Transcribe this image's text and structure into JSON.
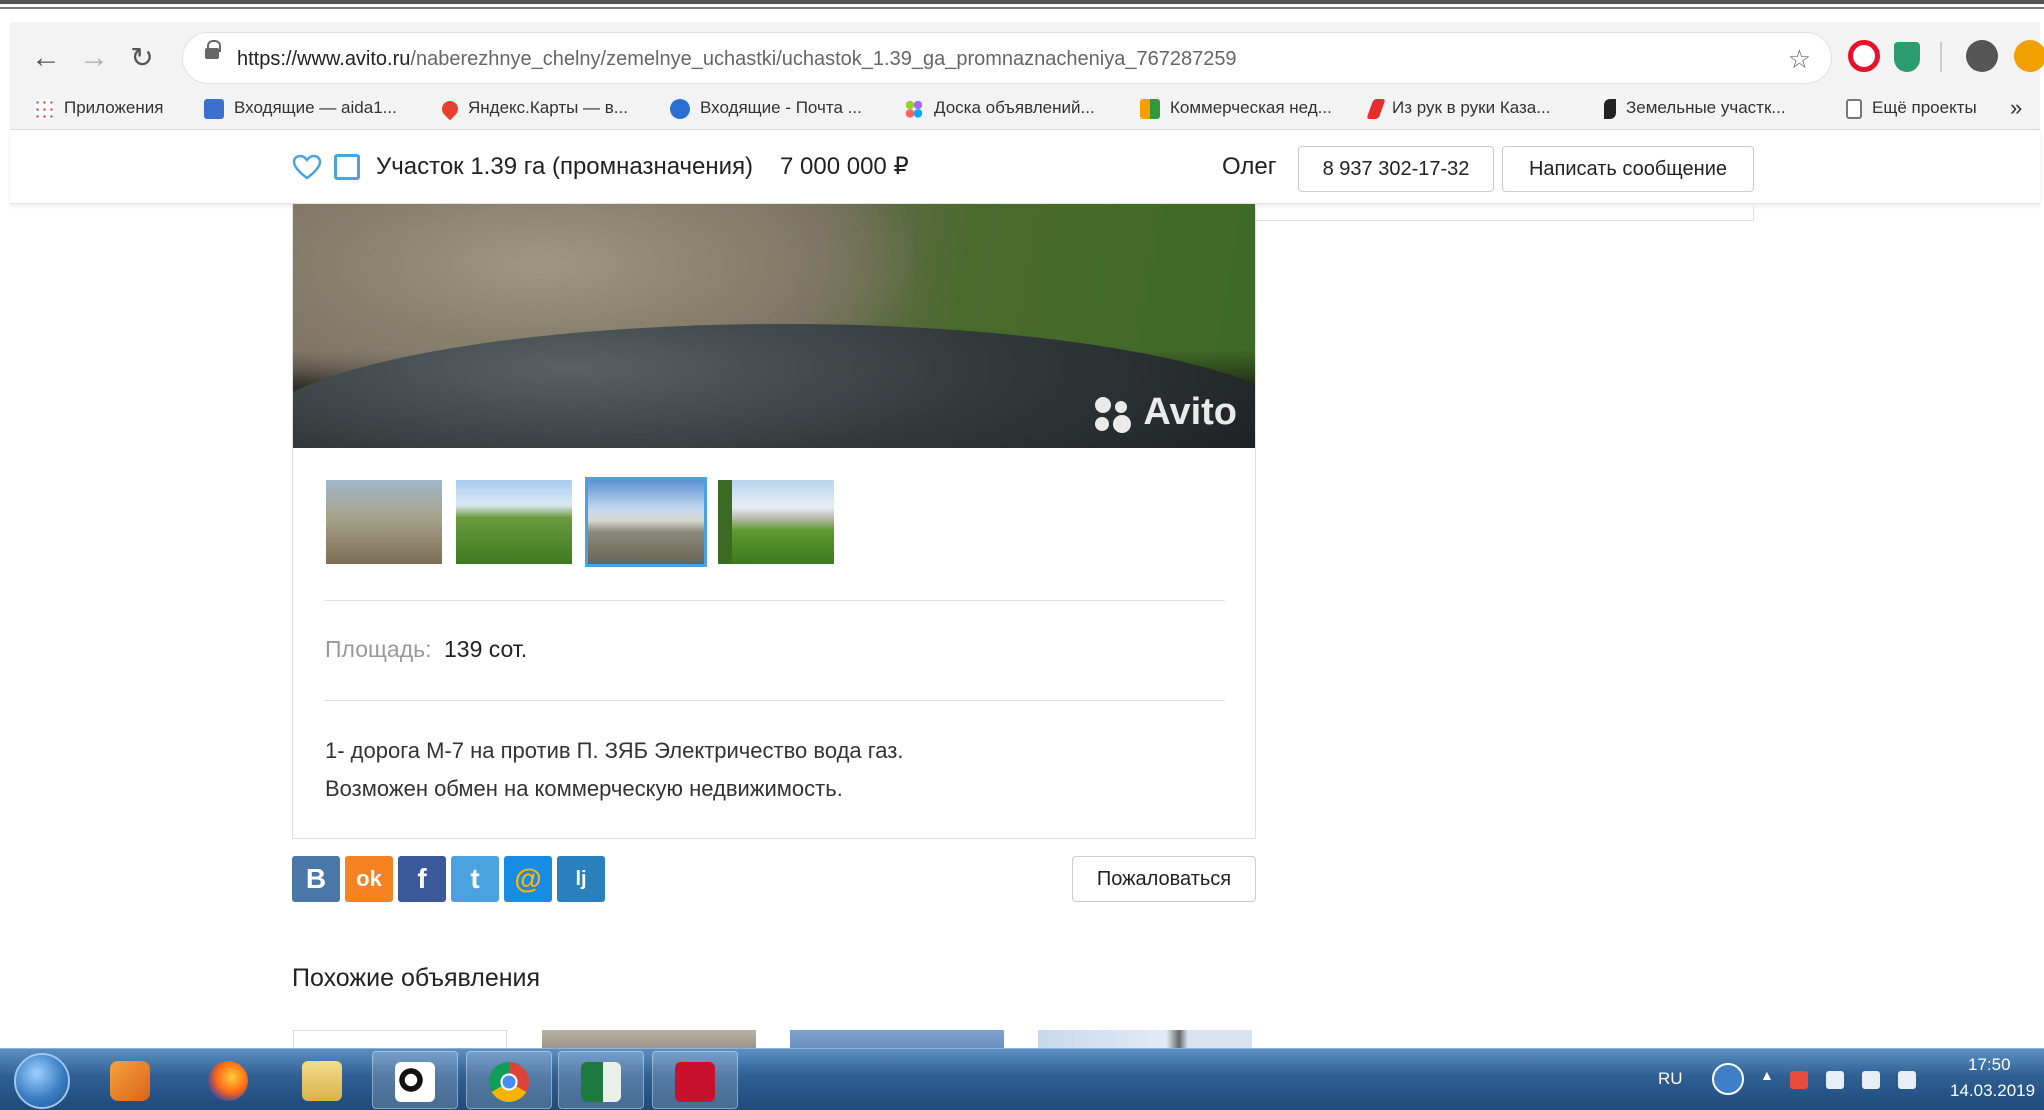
{
  "browser": {
    "url_host": "https://www.avito.ru",
    "url_path": "/naberezhnye_chelny/zemelnye_uchastki/uchastok_1.39_ga_promnaznacheniya_767287259",
    "bookmarks": [
      {
        "label": "Приложения",
        "icon": "apps-grid-icon"
      },
      {
        "label": "Входящие — aida1...",
        "icon": "mail-icon"
      },
      {
        "label": "Яндекс.Карты — в...",
        "icon": "map-pin-icon"
      },
      {
        "label": "Входящие - Почта ...",
        "icon": "mail-at-icon"
      },
      {
        "label": "Доска объявлений...",
        "icon": "avito-icon"
      },
      {
        "label": "Коммерческая нед...",
        "icon": "building-icon"
      },
      {
        "label": "Из рук в руки Каза...",
        "icon": "irr-icon"
      },
      {
        "label": "Земельные участк...",
        "icon": "land-icon"
      },
      {
        "label": "Ещё проекты",
        "icon": "file-icon"
      }
    ],
    "more_bookmarks": "»"
  },
  "header": {
    "title": "Участок 1.39 га (промназначения)",
    "price": "7 000 000 ₽",
    "seller": "Олег",
    "phone": "8 937 302-17-32",
    "message_button": "Написать сообщение"
  },
  "listing": {
    "watermark": "Avito",
    "selected_thumbnail": 3,
    "area_label": "Площадь:",
    "area_value": "139 сот.",
    "description_line1": "1- дорога М-7 на против П. ЗЯБ Электричество вода газ.",
    "description_line2": "Возможен обмен на коммерческую недвижимость.",
    "report_button": "Пожаловаться",
    "similar_title": "Похожие объявления",
    "share": [
      {
        "label": "В",
        "icon": "vk-icon",
        "color": "#4a76a8"
      },
      {
        "label": "ok",
        "icon": "odnoklassniki-icon",
        "color": "#f58220"
      },
      {
        "label": "f",
        "icon": "facebook-icon",
        "color": "#3b5998"
      },
      {
        "label": "t",
        "icon": "twitter-icon",
        "color": "#4aa3df"
      },
      {
        "label": "@",
        "icon": "mailru-icon",
        "color": "#168de2"
      },
      {
        "label": "lj",
        "icon": "livejournal-icon",
        "color": "#2a7fbd"
      }
    ]
  },
  "taskbar": {
    "language": "RU",
    "time": "17:50",
    "date": "14.03.2019"
  }
}
